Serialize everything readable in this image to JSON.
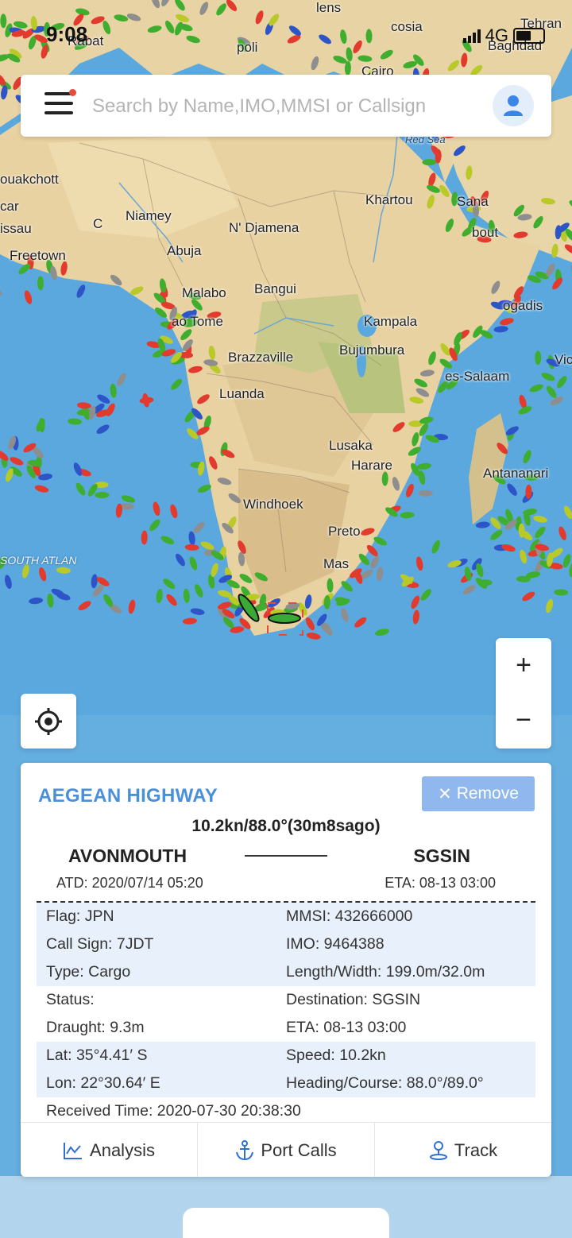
{
  "status_bar": {
    "time": "9:08",
    "network": "4G"
  },
  "search": {
    "placeholder": "Search by Name,IMO,MMSI or Callsign"
  },
  "map": {
    "labels": [
      "Rabat",
      "Tehran",
      "Baghdad",
      "Red Sea",
      "ouakchott",
      "car",
      "issau",
      "Freetown",
      "Niamey",
      "C",
      "Abuja",
      "N' Djamena",
      "Khartou",
      "Sana",
      "bout",
      "Malabo",
      "Bangui",
      "Kampala",
      "Bujumbura",
      "ao Tome",
      "Brazzaville",
      "Luanda",
      "ogadis",
      "es-Salaam",
      "Vic",
      "Lusaka",
      "Harare",
      "Antananari",
      "Windhoek",
      "Preto",
      "Mas",
      "SOUTH ATLAN",
      "cosia",
      "lens",
      "Cairo",
      "poli"
    ],
    "water_color": "#5aa7dd",
    "land_color": "#e8d5a6"
  },
  "zoom": {
    "in_label": "+",
    "out_label": "−"
  },
  "vessel": {
    "name": "AEGEAN HIGHWAY",
    "remove_label": "Remove",
    "speed_line": "10.2kn/88.0°(30m8sago)",
    "from_port": "AVONMOUTH",
    "to_port": "SGSIN",
    "atd": "ATD: 2020/07/14 05:20",
    "eta": "ETA: 08-13 03:00",
    "info_rows": [
      {
        "left": "Flag: JPN",
        "right": "MMSI: 432666000",
        "shade": true
      },
      {
        "left": "Call Sign: 7JDT",
        "right": "IMO: 9464388",
        "shade": true
      },
      {
        "left": "Type: Cargo",
        "right": "Length/Width: 199.0m/32.0m",
        "shade": true
      },
      {
        "left": "Status:",
        "right": "Destination: SGSIN",
        "shade": false
      },
      {
        "left": "Draught: 9.3m",
        "right": "ETA: 08-13 03:00",
        "shade": false
      },
      {
        "left": "Lat: 35°4.41′ S",
        "right": "Speed: 10.2kn",
        "shade": true
      },
      {
        "left": "Lon: 22°30.64′ E",
        "right": "Heading/Course: 88.0°/89.0°",
        "shade": true
      }
    ],
    "received": "Received Time: 2020-07-30 20:38:30"
  },
  "actions": {
    "analysis": "Analysis",
    "port_calls": "Port Calls",
    "track": "Track"
  },
  "colors": {
    "accent": "#4a8fd9",
    "remove_bg": "#90b8ee",
    "row_shade": "#e8f0fb"
  }
}
